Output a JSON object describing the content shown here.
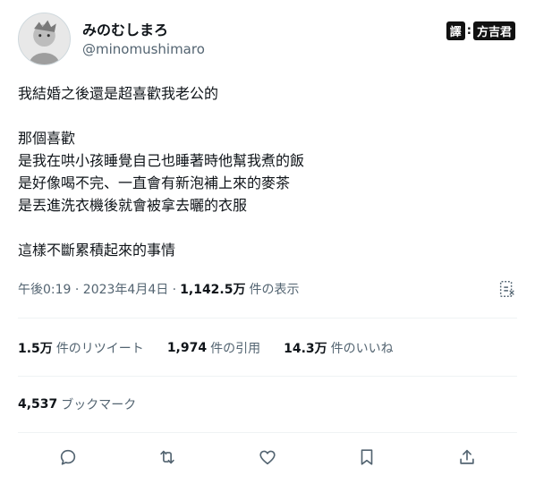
{
  "user": {
    "display_name": "みのむしまろ",
    "handle": "@minomushimaro"
  },
  "translator": {
    "tag": "譯",
    "separator": ":",
    "name": "方吉君"
  },
  "tweet": {
    "lines": [
      "我結婚之後還是超喜歡我老公的",
      "",
      "那個喜歡",
      "是我在哄小孩睡覺自己也睡著時他幫我煮的飯",
      "是好像喝不完、一直會有新泡補上來的麥茶",
      "是丟進洗衣機後就會被拿去曬的衣服",
      "",
      "這樣不斷累積起來的事情"
    ]
  },
  "meta": {
    "timestamp": "午後0:19 · 2023年4月4日 ·",
    "views_count": "1,142.5万",
    "views_label": "件の表示"
  },
  "stats": {
    "retweets_count": "1.5万",
    "retweets_label": "件のリツイート",
    "quotes_count": "1,974",
    "quotes_label": "件の引用",
    "likes_count": "14.3万",
    "likes_label": "件のいいね"
  },
  "bookmarks": {
    "count": "4,537",
    "label": "ブックマーク"
  },
  "icons": {
    "reply": "reply-icon",
    "retweet": "retweet-icon",
    "like": "heart-icon",
    "bookmark": "bookmark-icon",
    "share": "share-icon",
    "analytics": "analytics-icon"
  },
  "colors": {
    "text_primary": "#0f1419",
    "text_secondary": "#536471",
    "divider": "#eff3f4"
  }
}
